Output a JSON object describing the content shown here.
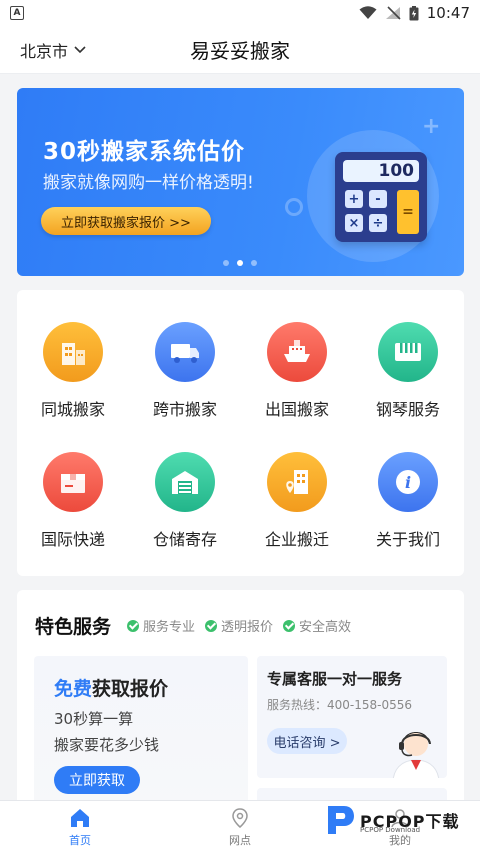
{
  "status_bar": {
    "time": "10:47"
  },
  "header": {
    "city": "北京市",
    "title": "易妥妥搬家"
  },
  "banner": {
    "title": "30秒搬家系统估价",
    "subtitle": "搬家就像网购一样价格透明!",
    "button_label": "立即获取搬家报价 >>",
    "calculator_display": "100",
    "calc_keys": [
      "+",
      "-",
      "×",
      "÷",
      "="
    ]
  },
  "services": [
    {
      "label": "同城搬家",
      "icon": "buildings-icon",
      "color": "#f5a623"
    },
    {
      "label": "跨市搬家",
      "icon": "truck-icon",
      "color": "#4d86f7"
    },
    {
      "label": "出国搬家",
      "icon": "ship-icon",
      "color": "#f2594b"
    },
    {
      "label": "钢琴服务",
      "icon": "piano-icon",
      "color": "#2fc59a"
    },
    {
      "label": "国际快递",
      "icon": "package-icon",
      "color": "#f2594b"
    },
    {
      "label": "仓储寄存",
      "icon": "warehouse-icon",
      "color": "#2fc59a"
    },
    {
      "label": "企业搬迁",
      "icon": "office-location-icon",
      "color": "#f5a623"
    },
    {
      "label": "关于我们",
      "icon": "info-icon",
      "color": "#4d86f7"
    }
  ],
  "featured": {
    "title": "特色服务",
    "tags": [
      "服务专业",
      "透明报价",
      "安全高效"
    ],
    "quote": {
      "title_highlight": "免费",
      "title_rest": "获取报价",
      "line1": "30秒算一算",
      "line2": "搬家要花多少钱",
      "button_label": "立即获取"
    },
    "service": {
      "title": "专属客服一对一服务",
      "phone": "服务热线：400-158-0556",
      "button_label": "电话咨询 >"
    }
  },
  "tabbar": {
    "tabs": [
      {
        "label": "首页",
        "active": true
      },
      {
        "label": "网点",
        "active": false
      },
      {
        "label": "我的",
        "active": false
      }
    ]
  },
  "watermark": {
    "text": "PCPOP下载",
    "sub": "PCPOP Download"
  }
}
